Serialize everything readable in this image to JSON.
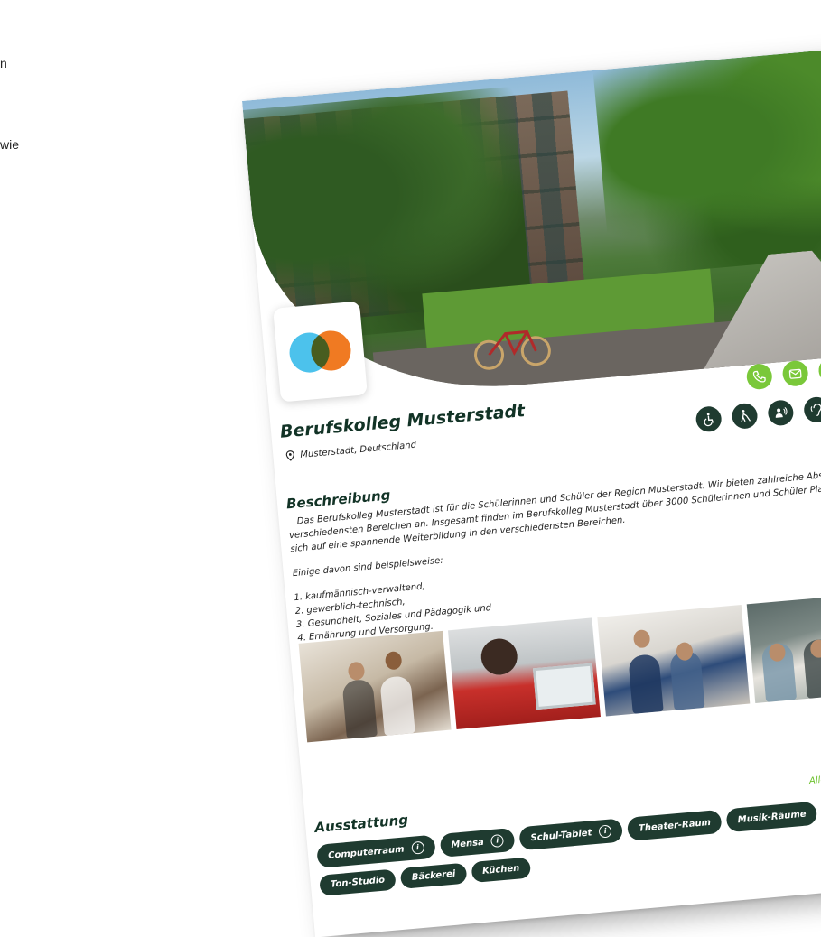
{
  "stray_text": {
    "line1": "n",
    "line2": "wie"
  },
  "profile": {
    "name": "Berufskolleg Musterstadt",
    "location": "Musterstadt, Deutschland"
  },
  "contact_icons": [
    "phone-icon",
    "mail-icon",
    "web-icon"
  ],
  "accessibility_icons": [
    "wheelchair-icon",
    "blind-walking-icon",
    "sign-language-icon",
    "hearing-icon"
  ],
  "description": {
    "title": "Beschreibung",
    "paragraph": "Das Berufskolleg Musterstadt ist für die Schülerinnen und Schüler der Region Musterstadt. Wir bieten zahlreiche Abschlüsse in den verschiedensten Bereichen an. Insgesamt finden im Berufskolleg Musterstadt über 3000 Schülerinnen und Schüler Platz und freuen sich auf eine spannende Weiterbildung in den verschiedensten Bereichen.",
    "examples_intro": "Einige davon sind beispielsweise:",
    "examples": [
      "kaufmännisch-verwaltend,",
      "gewerblich-technisch,",
      "Gesundheit, Soziales und Pädagogik und",
      "Ernährung und Versorgung."
    ]
  },
  "equipment": {
    "title": "Ausstattung",
    "see_all": "Alle Vorteile anzeigen",
    "items": [
      {
        "label": "Computerraum",
        "info": true
      },
      {
        "label": "Mensa",
        "info": true
      },
      {
        "label": "Schul-Tablet",
        "info": true
      },
      {
        "label": "Theater-Raum",
        "info": false
      },
      {
        "label": "Musik-Räume",
        "info": false
      },
      {
        "label": "Ton-Studio",
        "info": false
      },
      {
        "label": "Bäckerei",
        "info": false
      },
      {
        "label": "Küchen",
        "info": false
      }
    ]
  },
  "colors": {
    "accent_green": "#7ac83a",
    "dark_green": "#1f3b30",
    "logo_blue": "#4cc2ec",
    "logo_orange": "#f07a22"
  }
}
